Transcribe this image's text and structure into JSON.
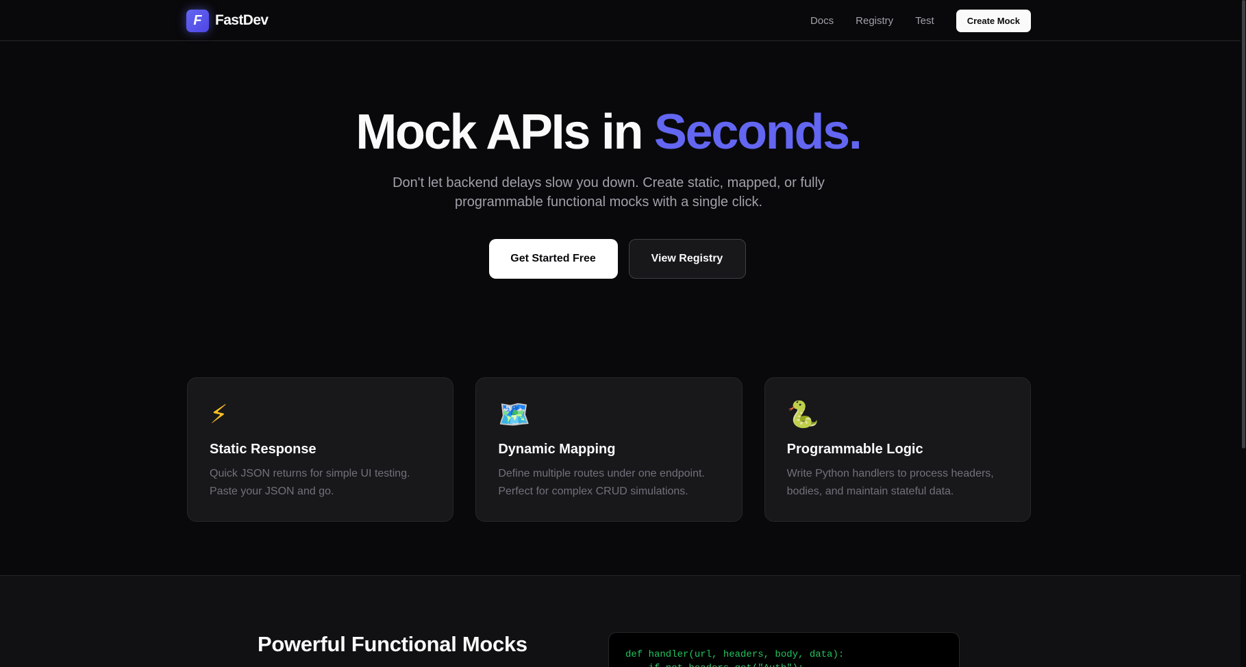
{
  "brand": {
    "logo_letter": "F",
    "name": "FastDev"
  },
  "nav": {
    "links": [
      "Docs",
      "Registry",
      "Test"
    ],
    "cta_label": "Create Mock"
  },
  "hero": {
    "title_main": "Mock APIs in ",
    "title_accent": "Seconds.",
    "subtitle_line1": "Don't let backend delays slow you down. Create static, mapped, or fully",
    "subtitle_line2": "programmable functional mocks with a single click.",
    "primary_button": "Get Started Free",
    "secondary_button": "View Registry"
  },
  "features": [
    {
      "icon": "lightning-bolt-icon",
      "glyph": "⚡",
      "title": "Static Response",
      "desc_line1": "Quick JSON returns for simple UI testing.",
      "desc_line2": "Paste your JSON and go."
    },
    {
      "icon": "map-icon",
      "glyph": "🗺️",
      "title": "Dynamic Mapping",
      "desc_line1": "Define multiple routes under one endpoint.",
      "desc_line2": "Perfect for complex CRUD simulations."
    },
    {
      "icon": "snake-icon",
      "glyph": "🐍",
      "title": "Programmable Logic",
      "desc_line1": "Write Python handlers to process headers,",
      "desc_line2": "bodies, and maintain stateful data."
    }
  ],
  "functional": {
    "title": "Powerful Functional Mocks",
    "code_line1": "def handler(url, headers, body, data):",
    "code_line2": "    if not headers.get(\"Auth\"):"
  },
  "colors": {
    "background": "#09090b",
    "accent": "#6366f1",
    "card": "#18181b",
    "code_green": "#22c55e"
  }
}
